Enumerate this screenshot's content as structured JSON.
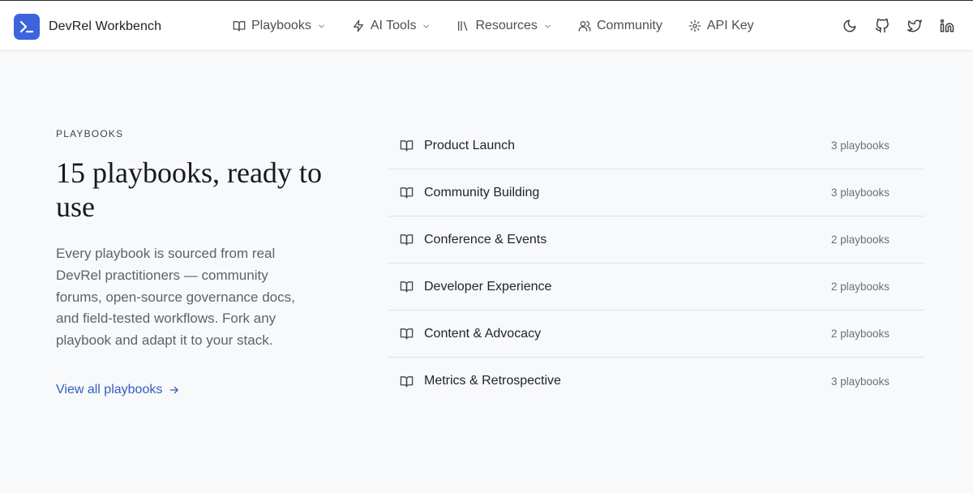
{
  "app": {
    "name": "DevRel Workbench",
    "logo_icon": "terminal-prompt-icon",
    "accent": "#3d63dd"
  },
  "nav": {
    "items": [
      {
        "label": "Playbooks",
        "icon": "book-open-icon",
        "dropdown": true
      },
      {
        "label": "AI Tools",
        "icon": "lightning-icon",
        "dropdown": true
      },
      {
        "label": "Resources",
        "icon": "library-icon",
        "dropdown": true
      },
      {
        "label": "Community",
        "icon": "users-icon",
        "dropdown": false
      },
      {
        "label": "API Key",
        "icon": "gear-icon",
        "dropdown": false
      }
    ]
  },
  "header_icons": [
    "moon-icon",
    "github-icon",
    "twitter-icon",
    "linkedin-icon"
  ],
  "hero": {
    "eyebrow": "PLAYBOOKS",
    "title": "15 playbooks, ready to use",
    "description": "Every playbook is sourced from real DevRel practitioners — community forums, open-source governance docs, and field-tested workflows. Fork any playbook and adapt it to your stack.",
    "link": "View all playbooks"
  },
  "categories": [
    {
      "label": "Product Launch",
      "count": "3 playbooks"
    },
    {
      "label": "Community Building",
      "count": "3 playbooks"
    },
    {
      "label": "Conference & Events",
      "count": "2 playbooks"
    },
    {
      "label": "Developer Experience",
      "count": "2 playbooks"
    },
    {
      "label": "Content & Advocacy",
      "count": "2 playbooks"
    },
    {
      "label": "Metrics & Retrospective",
      "count": "3 playbooks"
    }
  ]
}
